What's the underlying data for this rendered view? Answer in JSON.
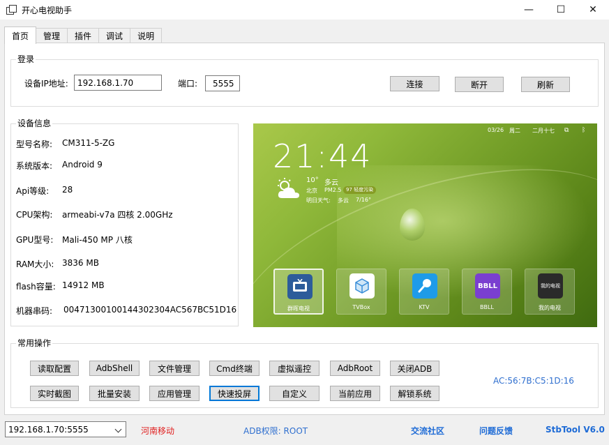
{
  "window": {
    "title": "开心电视助手",
    "min": "—",
    "max": "☐",
    "close": "✕"
  },
  "tabs": [
    "首页",
    "管理",
    "插件",
    "调试",
    "说明"
  ],
  "login": {
    "legend": "登录",
    "ip_label": "设备IP地址:",
    "ip_value": "192.168.1.70",
    "port_label": "端口:",
    "port_value": "5555",
    "connect": "连接",
    "disconnect": "断开",
    "refresh": "刷新"
  },
  "device_info": {
    "legend": "设备信息",
    "rows": [
      {
        "key": "型号名称:",
        "value": "CM311-5-ZG"
      },
      {
        "key": "系统版本:",
        "value": "Android 9"
      },
      {
        "key": "Api等级:",
        "value": "28"
      },
      {
        "key": "CPU架构:",
        "value": "armeabi-v7a 四核 2.00GHz"
      },
      {
        "key": "GPU型号:",
        "value": "Mali-450 MP 八核"
      },
      {
        "key": "RAM大小:",
        "value": "3836 MB"
      },
      {
        "key": "flash容量:",
        "value": "14912 MB"
      },
      {
        "key": "机器串码:",
        "value": "00471300100144302304AC567BC51D16"
      }
    ]
  },
  "tv_screen": {
    "date": "03/26",
    "weekday": "周二",
    "lunar": "二月十七",
    "time": "21:44",
    "temp": "10°",
    "condition": "多云",
    "city": "北京",
    "pm_label": "PM2.5",
    "pm_badge": "97 轻度污染",
    "tomorrow_label": "明日天气:",
    "tomorrow_cond": "多云",
    "tomorrow_temp": "7/16°",
    "apps": [
      {
        "name": "群晖电视",
        "icon_text": ""
      },
      {
        "name": "TVBox",
        "icon_text": ""
      },
      {
        "name": "KTV",
        "icon_text": ""
      },
      {
        "name": "BBLL",
        "icon_text": "BBLL"
      },
      {
        "name": "我的电视",
        "icon_text": "我的电视"
      }
    ]
  },
  "ops": {
    "legend": "常用操作",
    "row1": [
      "读取配置",
      "AdbShell",
      "文件管理",
      "Cmd终端",
      "虚拟遥控",
      "AdbRoot",
      "关闭ADB"
    ],
    "row2": [
      "实时截图",
      "批量安装",
      "应用管理",
      "快速投屏",
      "自定义",
      "当前应用",
      "解锁系统"
    ],
    "mac": "AC:56:7B:C5:1D:16"
  },
  "status": {
    "device_combo": "192.168.1.70:5555",
    "region": "河南移动",
    "adb_perm": "ADB权限: ROOT",
    "community": "交流社区",
    "feedback": "问题反馈",
    "version": "StbTool V6.0"
  },
  "colors": {
    "link_blue": "#1e6bd6",
    "red": "#e02020",
    "mac_blue": "#2f6fcf"
  }
}
